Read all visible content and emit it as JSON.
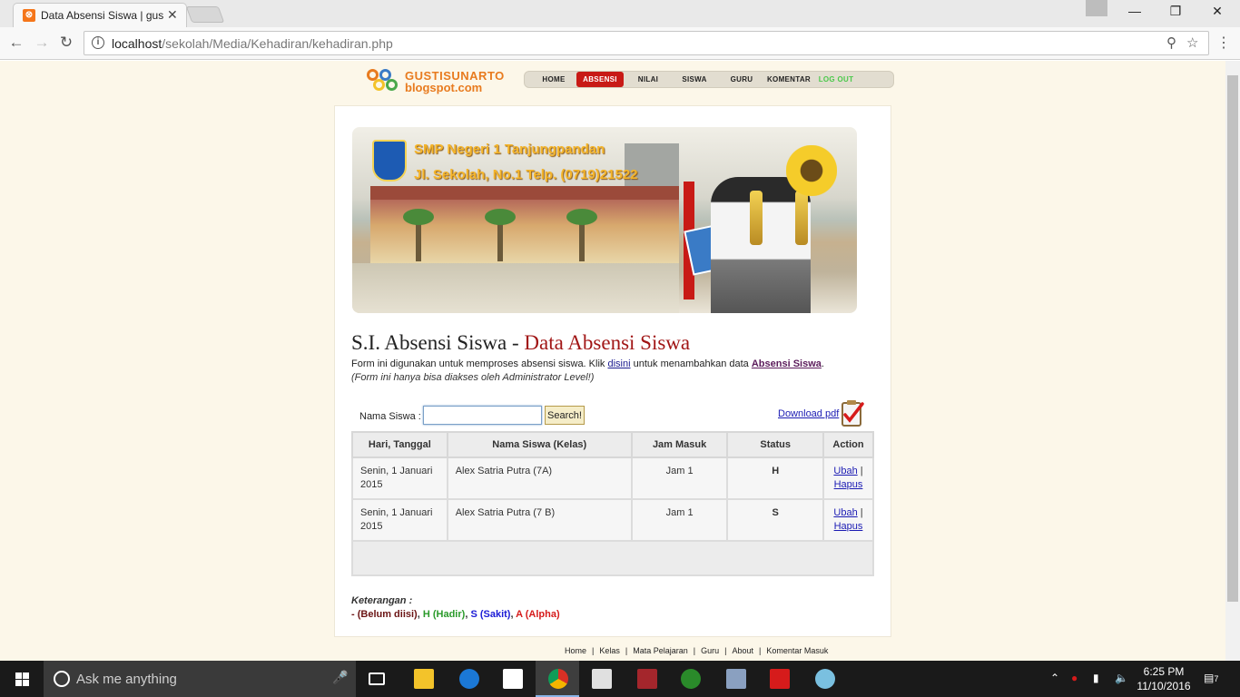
{
  "browser": {
    "tab_title": "Data Absensi Siswa | gus",
    "url_host": "localhost",
    "url_path": "/sekolah/Media/Kehadiran/kehadiran.php"
  },
  "site": {
    "logo_line1": "GUSTISUNARTO",
    "logo_line2": "blogspot.com",
    "nav": [
      "HOME",
      "ABSENSI",
      "NILAI",
      "SISWA",
      "GURU",
      "KOMENTAR",
      "LOG OUT"
    ],
    "active_nav": "ABSENSI"
  },
  "banner": {
    "school_name": "SMP Negeri 1 Tanjungpandan",
    "school_address": "Jl. Sekolah, No.1 Telp. (0719)21522"
  },
  "page": {
    "title_main": "S.I. Absensi Siswa - ",
    "title_sub": "Data Absensi Siswa",
    "desc_before": "Form ini digunakan untuk memproses absensi siswa. Klik ",
    "desc_link1": "disini",
    "desc_mid": " untuk menambahkan data ",
    "desc_link2": "Absensi Siswa",
    "desc_after": ".",
    "note": "(Form ini hanya bisa diakses oleh Administrator Level!)"
  },
  "search": {
    "label": "Nama Siswa :",
    "value": "",
    "button": "Search!",
    "download_label": "Download pdf"
  },
  "table": {
    "headers": [
      "Hari, Tanggal",
      "Nama Siswa (Kelas)",
      "Jam Masuk",
      "Status",
      "Action"
    ],
    "rows": [
      {
        "tanggal": "Senin, 1 Januari 2015",
        "nama": "Alex Satria Putra (7A)",
        "jam": "Jam 1",
        "status": "H",
        "edit": "Ubah",
        "sep": "|",
        "delete": "Hapus"
      },
      {
        "tanggal": "Senin, 1 Januari 2015",
        "nama": "Alex Satria Putra (7 B)",
        "jam": "Jam 1",
        "status": "S",
        "edit": "Ubah",
        "sep": "|",
        "delete": "Hapus"
      }
    ]
  },
  "legend": {
    "title": "Keterangan :",
    "items": [
      {
        "text": "- (Belum diisi)",
        "color": "#6b1414"
      },
      {
        "text": "H (Hadir)",
        "color": "#2a9a2a"
      },
      {
        "text": "S (Sakit)",
        "color": "#1b1bd6"
      },
      {
        "text": "A (Alpha)",
        "color": "#d61b1b"
      }
    ],
    "separator": ", "
  },
  "footer": {
    "links": [
      "Home",
      "Kelas",
      "Mata Pelajaran",
      "Guru",
      "About",
      "Komentar Masuk"
    ],
    "separator": "|"
  },
  "taskbar": {
    "search_placeholder": "Ask me anything",
    "time": "6:25 PM",
    "date": "11/10/2016",
    "notification_count": "7",
    "app_icons": [
      "task-view-icon",
      "file-explorer-icon",
      "edge-icon",
      "store-icon",
      "chrome-icon",
      "calendar-icon",
      "access-icon",
      "refresh-app-icon",
      "network-tool-icon",
      "acrobat-icon",
      "paint-icon"
    ]
  },
  "colors": {
    "page_bg": "#fcf7e9",
    "accent_red": "#c81a16",
    "heading_sub": "#a11616",
    "link_blue": "#1b1bb3"
  }
}
